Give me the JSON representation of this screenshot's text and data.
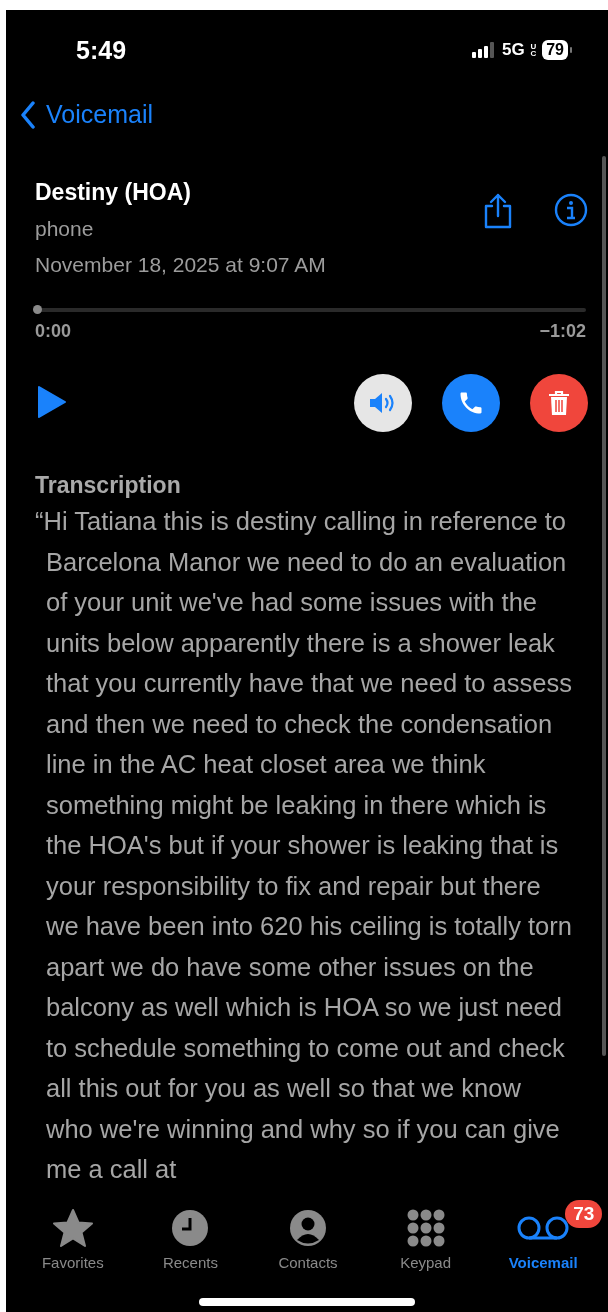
{
  "status_bar": {
    "time": "5:49",
    "network": "5G",
    "network_badge": "UC",
    "battery": "79"
  },
  "nav": {
    "back_label": "Voicemail"
  },
  "voicemail": {
    "caller": "Destiny (HOA)",
    "label": "phone",
    "date": "November 18, 2025 at 9:07 AM"
  },
  "player": {
    "level": 0,
    "elapsed": "0:00",
    "remaining": "−1:02",
    "speaker_on": true
  },
  "transcription": {
    "heading": "Transcription",
    "text": "“Hi Tatiana this is destiny calling in reference to Barcelona Manor we need to do an evaluation of your unit we've had some issues with the units below apparently there is a shower leak that you currently have that we need to assess and then we need to check the condensation line in the AC heat closet area we think something might be leaking in there which is the HOA's but if your shower is leaking that is your responsibility to fix and repair but there we have been into 620 his ceiling is totally torn apart we do have some other issues on the balcony as well which is HOA so we just need to schedule something to come out and check all this out for you as well so that we know who we're winning and why so if you can give me a call at"
  },
  "tabs": [
    {
      "kind": "favorites",
      "label": "Favorites",
      "selected": false
    },
    {
      "kind": "recents",
      "label": "Recents",
      "selected": false
    },
    {
      "kind": "contacts",
      "label": "Contacts",
      "selected": false
    },
    {
      "kind": "keypad",
      "label": "Keypad",
      "selected": false
    },
    {
      "kind": "voicemail",
      "label": "Voicemail",
      "selected": true,
      "badge": "73"
    }
  ]
}
